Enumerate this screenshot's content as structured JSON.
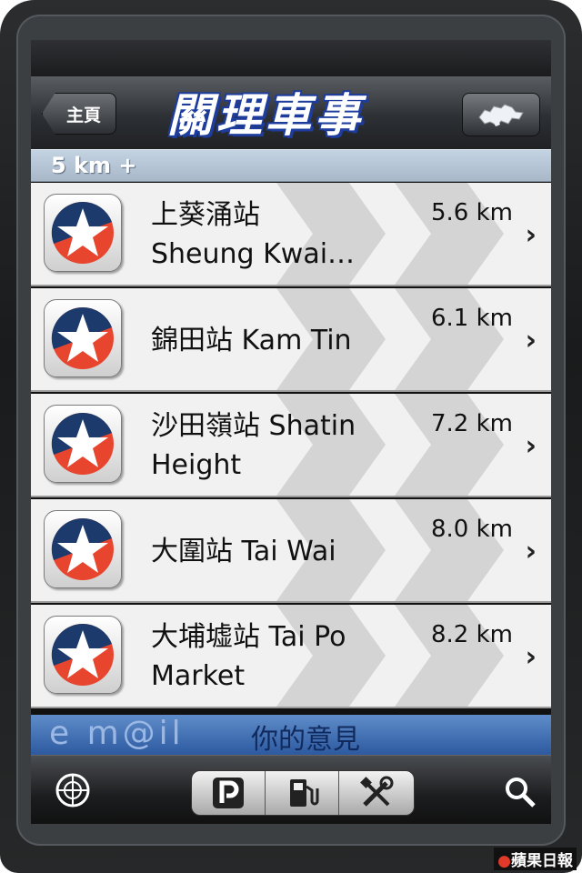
{
  "navbar": {
    "back_label": "主頁",
    "title": "關理車事"
  },
  "section": {
    "header": "5 km +"
  },
  "stations": [
    {
      "line1": "上葵涌站",
      "line2": "Sheung Kwai…",
      "distance": "5.6 km"
    },
    {
      "line1": "錦田站 Kam Tin",
      "line2": "",
      "distance": "6.1 km"
    },
    {
      "line1": "沙田嶺站 Shatin",
      "line2": "Height",
      "distance": "7.2 km"
    },
    {
      "line1": "大圍站 Tai Wai",
      "line2": "",
      "distance": "8.0 km"
    },
    {
      "line1": "大埔墟站 Tai Po",
      "line2": "Market",
      "distance": "8.2 km"
    }
  ],
  "banner": {
    "text": "你的意見",
    "deco": "e m@il"
  },
  "watermark": {
    "text": "蘋果日報"
  },
  "colors": {
    "caltex_red": "#e8452f",
    "caltex_navy": "#1c3a6b",
    "section_blue": "#b7c7d8",
    "banner_blue": "#3e6db4"
  },
  "icons": {
    "station": "caltex-star-icon",
    "tabs": [
      "radar-icon",
      "parking-icon",
      "fuel-pump-icon",
      "tools-icon",
      "search-icon"
    ],
    "map": "hong-kong-map-icon"
  }
}
